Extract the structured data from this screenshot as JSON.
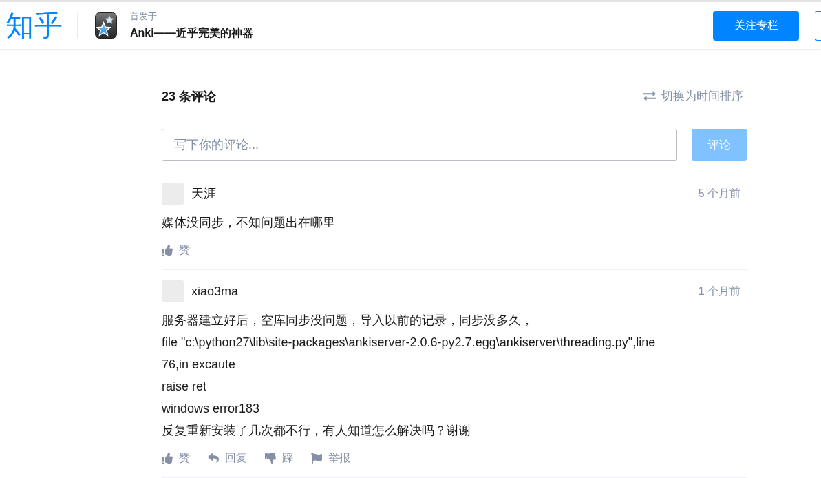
{
  "header": {
    "logo": "知乎",
    "column": {
      "label": "首发于",
      "title": "Anki——近乎完美的神器"
    },
    "follow_button": "关注专栏"
  },
  "comments_section": {
    "count_title": "23 条评论",
    "sort_toggle": "切换为时间排序",
    "comment_box": {
      "placeholder": "写下你的评论...",
      "submit": "评论",
      "disabled": true
    }
  },
  "comments": [
    {
      "author": "天涯",
      "time": "5 个月前",
      "body": "媒体没同步，不知问题出在哪里",
      "actions": [
        {
          "kind": "like",
          "label": "赞"
        }
      ]
    },
    {
      "author": "xiao3ma",
      "time": "1 个月前",
      "body": "服务器建立好后，空库同步没问题，导入以前的记录，同步没多久，\nfile \"c:\\python27\\lib\\site-packages\\ankiserver-2.0.6-py2.7.egg\\ankiserver\\threading.py\",line\n76,in excaute\nraise ret\nwindows error183\n反复重新安装了几次都不行，有人知道怎么解决吗？谢谢",
      "actions": [
        {
          "kind": "like",
          "label": "赞"
        },
        {
          "kind": "reply",
          "label": "回复"
        },
        {
          "kind": "dislike",
          "label": "踩"
        },
        {
          "kind": "report",
          "label": "举报"
        }
      ]
    }
  ]
}
